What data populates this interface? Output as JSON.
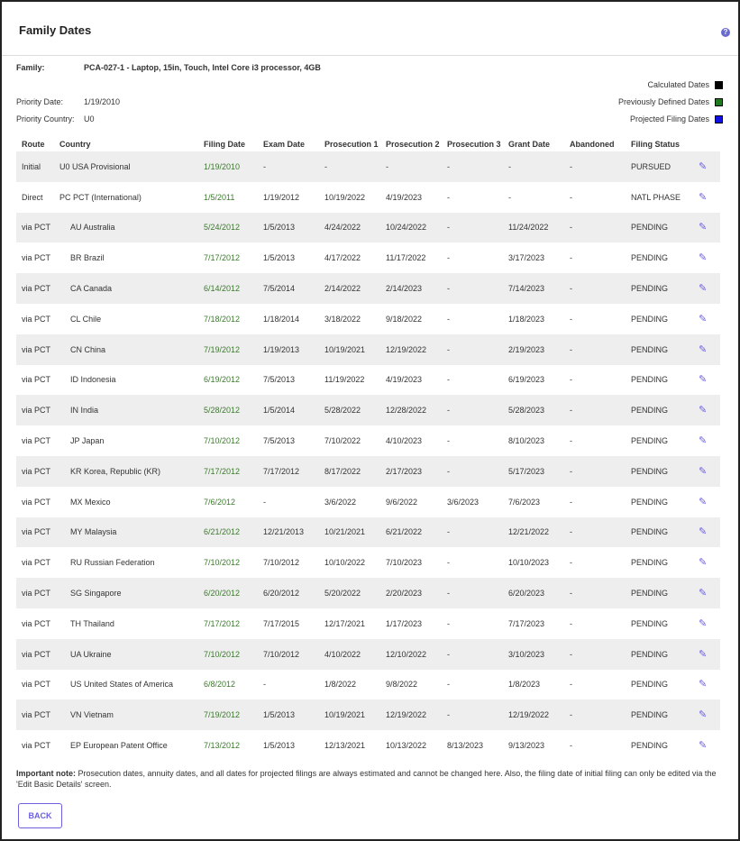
{
  "page": {
    "title": "Family Dates",
    "help_icon": "?"
  },
  "family": {
    "family_label": "Family:",
    "family_value": "PCA-027-1 - Laptop, 15in, Touch, Intel Core i3 processor, 4GB",
    "priority_date_label": "Priority Date:",
    "priority_date_value": "1/19/2010",
    "priority_country_label": "Priority Country:",
    "priority_country_value": "U0"
  },
  "legend": {
    "calculated": {
      "label": "Calculated Dates",
      "color": "#000000"
    },
    "previous": {
      "label": "Previously Defined Dates",
      "color": "#1f7a1f"
    },
    "projected": {
      "label": "Projected Filing Dates",
      "color": "#1010e0"
    }
  },
  "table": {
    "headers": [
      "Route",
      "Country",
      "Filing Date",
      "Exam Date",
      "Prosecution 1",
      "Prosecution 2",
      "Prosecution 3",
      "Grant Date",
      "Abandoned",
      "Filing Status"
    ],
    "rows": [
      {
        "route": "Initial",
        "country": "U0 USA Provisional",
        "filing": "1/19/2010",
        "exam": "-",
        "pros1": "-",
        "pros2": "-",
        "pros3": "-",
        "grant": "-",
        "abandoned": "-",
        "status": "PURSUED"
      },
      {
        "route": "Direct",
        "country": "PC PCT (International)",
        "filing": "1/5/2011",
        "exam": "1/19/2012",
        "pros1": "10/19/2022",
        "pros2": "4/19/2023",
        "pros3": "-",
        "grant": "-",
        "abandoned": "-",
        "status": "NATL PHASE"
      },
      {
        "route": "via PCT",
        "country": "AU Australia",
        "filing": "5/24/2012",
        "exam": "1/5/2013",
        "pros1": "4/24/2022",
        "pros2": "10/24/2022",
        "pros3": "-",
        "grant": "11/24/2022",
        "abandoned": "-",
        "status": "PENDING"
      },
      {
        "route": "via PCT",
        "country": "BR Brazil",
        "filing": "7/17/2012",
        "exam": "1/5/2013",
        "pros1": "4/17/2022",
        "pros2": "11/17/2022",
        "pros3": "-",
        "grant": "3/17/2023",
        "abandoned": "-",
        "status": "PENDING"
      },
      {
        "route": "via PCT",
        "country": "CA Canada",
        "filing": "6/14/2012",
        "exam": "7/5/2014",
        "pros1": "2/14/2022",
        "pros2": "2/14/2023",
        "pros3": "-",
        "grant": "7/14/2023",
        "abandoned": "-",
        "status": "PENDING"
      },
      {
        "route": "via PCT",
        "country": "CL Chile",
        "filing": "7/18/2012",
        "exam": "1/18/2014",
        "pros1": "3/18/2022",
        "pros2": "9/18/2022",
        "pros3": "-",
        "grant": "1/18/2023",
        "abandoned": "-",
        "status": "PENDING"
      },
      {
        "route": "via PCT",
        "country": "CN China",
        "filing": "7/19/2012",
        "exam": "1/19/2013",
        "pros1": "10/19/2021",
        "pros2": "12/19/2022",
        "pros3": "-",
        "grant": "2/19/2023",
        "abandoned": "-",
        "status": "PENDING"
      },
      {
        "route": "via PCT",
        "country": "ID Indonesia",
        "filing": "6/19/2012",
        "exam": "7/5/2013",
        "pros1": "11/19/2022",
        "pros2": "4/19/2023",
        "pros3": "-",
        "grant": "6/19/2023",
        "abandoned": "-",
        "status": "PENDING"
      },
      {
        "route": "via PCT",
        "country": "IN India",
        "filing": "5/28/2012",
        "exam": "1/5/2014",
        "pros1": "5/28/2022",
        "pros2": "12/28/2022",
        "pros3": "-",
        "grant": "5/28/2023",
        "abandoned": "-",
        "status": "PENDING"
      },
      {
        "route": "via PCT",
        "country": "JP Japan",
        "filing": "7/10/2012",
        "exam": "7/5/2013",
        "pros1": "7/10/2022",
        "pros2": "4/10/2023",
        "pros3": "-",
        "grant": "8/10/2023",
        "abandoned": "-",
        "status": "PENDING"
      },
      {
        "route": "via PCT",
        "country": "KR Korea, Republic (KR)",
        "filing": "7/17/2012",
        "exam": "7/17/2012",
        "pros1": "8/17/2022",
        "pros2": "2/17/2023",
        "pros3": "-",
        "grant": "5/17/2023",
        "abandoned": "-",
        "status": "PENDING"
      },
      {
        "route": "via PCT",
        "country": "MX Mexico",
        "filing": "7/6/2012",
        "exam": "-",
        "pros1": "3/6/2022",
        "pros2": "9/6/2022",
        "pros3": "3/6/2023",
        "grant": "7/6/2023",
        "abandoned": "-",
        "status": "PENDING"
      },
      {
        "route": "via PCT",
        "country": "MY Malaysia",
        "filing": "6/21/2012",
        "exam": "12/21/2013",
        "pros1": "10/21/2021",
        "pros2": "6/21/2022",
        "pros3": "-",
        "grant": "12/21/2022",
        "abandoned": "-",
        "status": "PENDING"
      },
      {
        "route": "via PCT",
        "country": "RU Russian Federation",
        "filing": "7/10/2012",
        "exam": "7/10/2012",
        "pros1": "10/10/2022",
        "pros2": "7/10/2023",
        "pros3": "-",
        "grant": "10/10/2023",
        "abandoned": "-",
        "status": "PENDING"
      },
      {
        "route": "via PCT",
        "country": "SG Singapore",
        "filing": "6/20/2012",
        "exam": "6/20/2012",
        "pros1": "5/20/2022",
        "pros2": "2/20/2023",
        "pros3": "-",
        "grant": "6/20/2023",
        "abandoned": "-",
        "status": "PENDING"
      },
      {
        "route": "via PCT",
        "country": "TH Thailand",
        "filing": "7/17/2012",
        "exam": "7/17/2015",
        "pros1": "12/17/2021",
        "pros2": "1/17/2023",
        "pros3": "-",
        "grant": "7/17/2023",
        "abandoned": "-",
        "status": "PENDING"
      },
      {
        "route": "via PCT",
        "country": "UA Ukraine",
        "filing": "7/10/2012",
        "exam": "7/10/2012",
        "pros1": "4/10/2022",
        "pros2": "12/10/2022",
        "pros3": "-",
        "grant": "3/10/2023",
        "abandoned": "-",
        "status": "PENDING"
      },
      {
        "route": "via PCT",
        "country": "US United States of America",
        "filing": "6/8/2012",
        "exam": "-",
        "pros1": "1/8/2022",
        "pros2": "9/8/2022",
        "pros3": "-",
        "grant": "1/8/2023",
        "abandoned": "-",
        "status": "PENDING"
      },
      {
        "route": "via PCT",
        "country": "VN Vietnam",
        "filing": "7/19/2012",
        "exam": "1/5/2013",
        "pros1": "10/19/2021",
        "pros2": "12/19/2022",
        "pros3": "-",
        "grant": "12/19/2022",
        "abandoned": "-",
        "status": "PENDING"
      },
      {
        "route": "via PCT",
        "country": "EP European Patent Office",
        "filing": "7/13/2012",
        "exam": "1/5/2013",
        "pros1": "12/13/2021",
        "pros2": "10/13/2022",
        "pros3": "8/13/2023",
        "grant": "9/13/2023",
        "abandoned": "-",
        "status": "PENDING"
      }
    ]
  },
  "note": {
    "label": "Important note:",
    "text": " Prosecution dates, annuity dates, and all dates for projected filings are always estimated and cannot be changed here. Also, the filing date of initial filing can only be edited via the 'Edit Basic Details' screen."
  },
  "back_button": {
    "label": "BACK"
  },
  "icons": {
    "edit": "pencil-icon",
    "help": "help-icon"
  }
}
